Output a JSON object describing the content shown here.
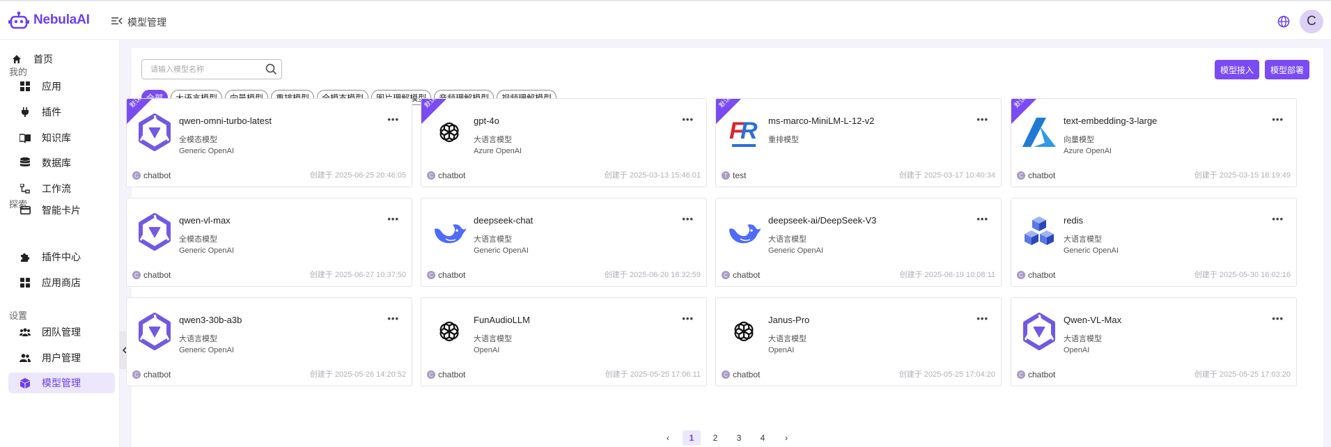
{
  "app": {
    "name": "NebulaAI",
    "page_title": "模型管理",
    "avatar_letter": "C"
  },
  "sidebar": {
    "home": "首页",
    "sections": [
      {
        "label": "我的",
        "items": [
          {
            "label": "应用",
            "icon": "grid-icon"
          },
          {
            "label": "插件",
            "icon": "plug-icon"
          },
          {
            "label": "知识库",
            "icon": "book-icon"
          },
          {
            "label": "数据库",
            "icon": "database-icon"
          },
          {
            "label": "工作流",
            "icon": "workflow-icon"
          },
          {
            "label": "智能卡片",
            "icon": "card-icon"
          }
        ]
      },
      {
        "label": "探索",
        "items": [
          {
            "label": "插件中心",
            "icon": "puzzle-icon"
          },
          {
            "label": "应用商店",
            "icon": "store-icon"
          }
        ]
      },
      {
        "label": "设置",
        "items": [
          {
            "label": "团队管理",
            "icon": "team-icon"
          },
          {
            "label": "用户管理",
            "icon": "users-icon"
          },
          {
            "label": "模型管理",
            "icon": "cube-icon",
            "active": true
          }
        ]
      }
    ]
  },
  "toolbar": {
    "search_placeholder": "请输入模型名称",
    "btn_connect": "模型接入",
    "btn_deploy": "模型部署"
  },
  "tabs": [
    "全部",
    "大语言模型",
    "向量模型",
    "重排模型",
    "全模态模型",
    "图片理解模型",
    "音频理解模型",
    "视频理解模型"
  ],
  "default_badge": "默认",
  "created_prefix": "创建于",
  "cards": [
    {
      "name": "qwen-omni-turbo-latest",
      "type": "全模态模型",
      "provider": "Generic OpenAI",
      "owner": "chatbot",
      "owner_initial": "C",
      "created": "2025-06-25 20:46:05",
      "default": true,
      "icon": "qwen-icon"
    },
    {
      "name": "gpt-4o",
      "type": "大语言模型",
      "provider": "Azure OpenAI",
      "owner": "chatbot",
      "owner_initial": "C",
      "created": "2025-03-13 15:46:01",
      "default": true,
      "icon": "openai-icon"
    },
    {
      "name": "ms-marco-MiniLM-L-12-v2",
      "type": "重排模型",
      "provider": "",
      "owner": "test",
      "owner_initial": "T",
      "created": "2025-03-17 10:40:34",
      "default": true,
      "icon": "flashrank-icon"
    },
    {
      "name": "text-embedding-3-large",
      "type": "向量模型",
      "provider": "Azure OpenAI",
      "owner": "chatbot",
      "owner_initial": "C",
      "created": "2025-03-15 18:19:49",
      "default": true,
      "icon": "azure-icon"
    },
    {
      "name": "qwen-vl-max",
      "type": "全模态模型",
      "provider": "Generic OpenAI",
      "owner": "chatbot",
      "owner_initial": "C",
      "created": "2025-06-27 10:37:50",
      "default": false,
      "icon": "qwen-icon"
    },
    {
      "name": "deepseek-chat",
      "type": "大语言模型",
      "provider": "Generic OpenAI",
      "owner": "chatbot",
      "owner_initial": "C",
      "created": "2025-06-20 18:32:59",
      "default": false,
      "icon": "deepseek-icon"
    },
    {
      "name": "deepseek-ai/DeepSeek-V3",
      "type": "大语言模型",
      "provider": "Generic OpenAI",
      "owner": "chatbot",
      "owner_initial": "C",
      "created": "2025-06-19 10:08:11",
      "default": false,
      "icon": "deepseek-icon"
    },
    {
      "name": "redis",
      "type": "大语言模型",
      "provider": "Generic OpenAI",
      "owner": "chatbot",
      "owner_initial": "C",
      "created": "2025-05-30 16:02:16",
      "default": false,
      "icon": "cubes-icon"
    },
    {
      "name": "qwen3-30b-a3b",
      "type": "大语言模型",
      "provider": "Generic OpenAI",
      "owner": "chatbot",
      "owner_initial": "C",
      "created": "2025-05-26 14:20:52",
      "default": false,
      "icon": "qwen-icon"
    },
    {
      "name": "FunAudioLLM",
      "type": "大语言模型",
      "provider": "OpenAI",
      "owner": "chatbot",
      "owner_initial": "C",
      "created": "2025-05-25 17:06:11",
      "default": false,
      "icon": "openai-icon"
    },
    {
      "name": "Janus-Pro",
      "type": "大语言模型",
      "provider": "OpenAI",
      "owner": "chatbot",
      "owner_initial": "C",
      "created": "2025-05-25 17:04:20",
      "default": false,
      "icon": "openai-icon"
    },
    {
      "name": "Qwen-VL-Max",
      "type": "大语言模型",
      "provider": "OpenAI",
      "owner": "chatbot",
      "owner_initial": "C",
      "created": "2025-05-25 17:03:20",
      "default": false,
      "icon": "qwen-icon"
    }
  ],
  "pagination": {
    "pages": [
      "1",
      "2",
      "3",
      "4"
    ],
    "current": "1",
    "prev": "‹",
    "next": "›"
  },
  "colors": {
    "accent": "#7a4bf5"
  }
}
